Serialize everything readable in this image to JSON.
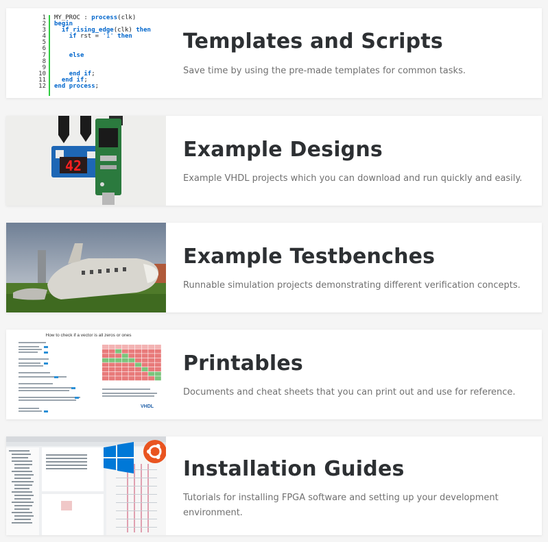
{
  "cards": [
    {
      "title": "Templates and Scripts",
      "desc": "Save time by using the pre-made templates for common tasks.",
      "code": {
        "line_numbers": [
          "1",
          "2",
          "3",
          "4",
          "5",
          "6",
          "7",
          "8",
          "9",
          "10",
          "11",
          "12"
        ],
        "lines": [
          "MY_PROC : process(clk)",
          "begin",
          "  if rising_edge(clk) then",
          "    if rst = '1' then",
          "",
          "",
          "    else",
          "",
          "",
          "    end if;",
          "  end if;",
          "end process;"
        ]
      }
    },
    {
      "title": "Example Designs",
      "desc": "Example VHDL projects which you can download and run quickly and easily.",
      "display_digits": "42"
    },
    {
      "title": "Example Testbenches",
      "desc": "Runnable simulation projects demonstrating different verification concepts."
    },
    {
      "title": "Printables",
      "desc": "Documents and cheat sheets that you can print out and use for reference.",
      "sheet_title": "How to check if a vector is all zeros or ones"
    },
    {
      "title": "Installation Guides",
      "desc1": "Tutorials for installing FPGA software and setting up your development",
      "desc2": "environment."
    }
  ],
  "colors": {
    "title": "#2d3033",
    "desc": "#707070",
    "code_bar": "#2ecc40",
    "code_keyword": "#0066cc",
    "ubuntu": "#e95420",
    "windows": "#0078d7"
  }
}
